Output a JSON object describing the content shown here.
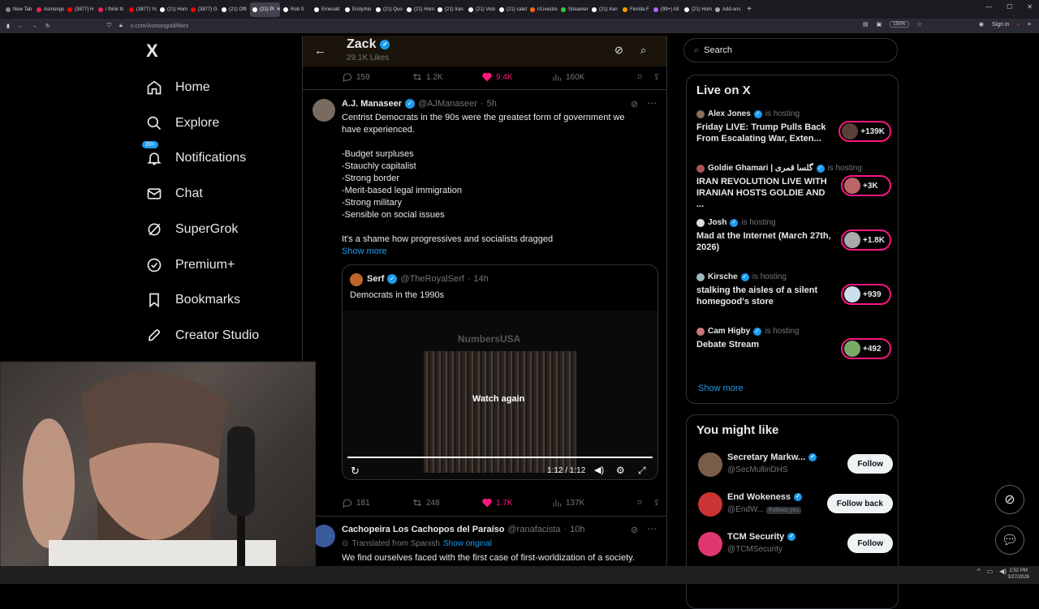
{
  "browser": {
    "tabs": [
      {
        "label": "New Tab",
        "color": "#888"
      },
      {
        "label": "Asmongo",
        "color": "#e25"
      },
      {
        "label": "(3877) H",
        "color": "#f00"
      },
      {
        "label": "i think th",
        "color": "#e25"
      },
      {
        "label": "(3877) Yo",
        "color": "#f00"
      },
      {
        "label": "(21) Hom",
        "color": "#fff"
      },
      {
        "label": "(3877) G",
        "color": "#f00"
      },
      {
        "label": "(21) Offi",
        "color": "#fff"
      },
      {
        "label": "(21) Pi",
        "color": "#fff",
        "active": true
      },
      {
        "label": "Rob S",
        "color": "#fff"
      },
      {
        "label": "Emerald",
        "color": "#fff"
      },
      {
        "label": "Endymio",
        "color": "#fff"
      },
      {
        "label": "(21) Quo",
        "color": "#fff"
      },
      {
        "label": "(21) Hom",
        "color": "#fff"
      },
      {
        "label": "(21) Iran",
        "color": "#fff"
      },
      {
        "label": "(21) Volo",
        "color": "#fff"
      },
      {
        "label": "(21) calet",
        "color": "#fff"
      },
      {
        "label": "r/Livestre",
        "color": "#f60"
      },
      {
        "label": "Streamer",
        "color": "#3c3"
      },
      {
        "label": "(21) Iran",
        "color": "#fff"
      },
      {
        "label": "Florida F",
        "color": "#f90"
      },
      {
        "label": "(99+) All",
        "color": "#a6f"
      },
      {
        "label": "(21) Hom",
        "color": "#fff"
      },
      {
        "label": "Add-ons",
        "color": "#aaa"
      }
    ],
    "url": "x.com/Asmongold/likes",
    "zoom": "150%",
    "sign_in": "Sign in"
  },
  "sidebar": {
    "logo": "X",
    "items": [
      {
        "label": "Home",
        "icon": "home-icon"
      },
      {
        "label": "Explore",
        "icon": "search-icon"
      },
      {
        "label": "Notifications",
        "icon": "bell-icon",
        "badge": "20+"
      },
      {
        "label": "Chat",
        "icon": "mail-icon"
      },
      {
        "label": "SuperGrok",
        "icon": "grok-icon"
      },
      {
        "label": "Premium+",
        "icon": "premium-icon"
      },
      {
        "label": "Bookmarks",
        "icon": "bookmark-icon"
      },
      {
        "label": "Creator Studio",
        "icon": "rocket-icon"
      }
    ]
  },
  "header": {
    "title": "Zack",
    "subtitle": "29.1K Likes"
  },
  "tweets": [
    {
      "replies": "159",
      "reposts": "1.2K",
      "likes": "9.4K",
      "views": "160K"
    },
    {
      "name": "A.J. Manaseer",
      "handle": "@AJManaseer",
      "time": "5h",
      "lines": [
        "Centrist Democrats in the 90s were the greatest form of government we",
        "have experienced.",
        "",
        "-Budget surpluses",
        "-Stauchly capitalist",
        "-Strong border",
        "-Merit-based legal immigration",
        "-Strong military",
        "-Sensible on social issues",
        "",
        "It's a shame how progressives and socialists dragged"
      ],
      "show_more": "Show more",
      "quote": {
        "name": "Serf",
        "handle": "@TheRoyalSerf",
        "time": "14h",
        "text": "Democrats in the 1990s",
        "video_brand": "NumbersUSA",
        "video_overlay": "Watch again",
        "video_time": "1:12 / 1:12"
      },
      "replies": "181",
      "reposts": "248",
      "likes": "1.7K",
      "views": "137K"
    },
    {
      "name": "Cachopeira Los Cachopos del Paraíso",
      "handle": "@ranafacista",
      "time": "10h",
      "translated": "Translated from Spanish",
      "show_original": "Show original",
      "text": "We find ourselves faced with the first case of first-worldization of a society."
    }
  ],
  "right": {
    "search_placeholder": "Search",
    "live_title": "Live on X",
    "hosting": "is hosting",
    "live": [
      {
        "host": "Alex Jones",
        "title": "Friday LIVE: Trump Pulls Back From Escalating War, Exten...",
        "count": "+139K"
      },
      {
        "host": "Goldie Ghamari | گلسا قمری",
        "title": "IRAN REVOLUTION LIVE WITH IRANIAN HOSTS GOLDIE AND ...",
        "count": "+3K"
      },
      {
        "host": "Josh",
        "title": "Mad at the Internet (March 27th, 2026)",
        "count": "+1.8K"
      },
      {
        "host": "Kirsche",
        "title": "stalking the aisles of a silent homegood's store",
        "count": "+939"
      },
      {
        "host": "Cam Higby",
        "title": "Debate Stream",
        "count": "+492"
      }
    ],
    "show_more": "Show more",
    "wtf_title": "You might like",
    "wtf": [
      {
        "name": "Secretary Markw...",
        "handle": "@SecMullinDHS",
        "button": "Follow"
      },
      {
        "name": "End Wokeness",
        "handle": "@EndW...",
        "follows_you": "Follows you",
        "button": "Follow back"
      },
      {
        "name": "TCM Security",
        "handle": "@TCMSecurity",
        "button": "Follow"
      }
    ]
  },
  "taskbar": {
    "time": "2:52 PM",
    "date": "3/27/2026"
  },
  "colors": {
    "accent": "#1d9bf0",
    "like": "#f91880",
    "bg": "#000000"
  }
}
